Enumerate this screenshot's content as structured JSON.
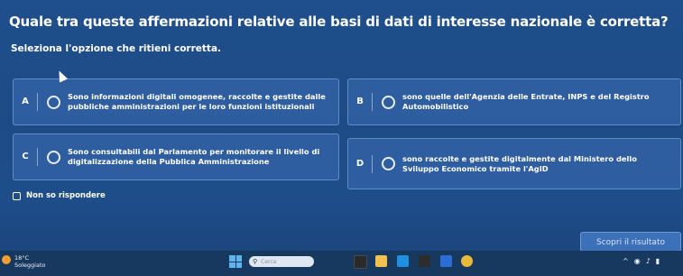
{
  "question": "Quale tra queste affermazioni relative alle basi di dati di interesse nazionale è corretta?",
  "instruction": "Seleziona l'opzione che ritieni corretta.",
  "options": [
    {
      "letter": "A",
      "text": "Sono informazioni digitali omogenee, raccolte e gestite dalle pubbliche amministrazioni per le loro funzioni istituzionali"
    },
    {
      "letter": "B",
      "text": "sono quelle dell'Agenzia delle Entrate, INPS e del Registro Automobilistico"
    },
    {
      "letter": "C",
      "text": "Sono consultabili dal Parlamento per monitorare il livello di digitalizzazione della Pubblica Amministrazione"
    },
    {
      "letter": "D",
      "text": "sono raccolte e gestite digitalmente dal Ministero dello Sviluppo Economico tramite l'AgID"
    }
  ],
  "dont_know": "Non so rispondere",
  "reveal_button": "Scopri il risultato",
  "taskbar": {
    "weather_temp": "18°C",
    "weather_desc": "Soleggiato",
    "search_placeholder": "Cerca"
  },
  "colors": {
    "background": "#1d4b86",
    "option_bg": "#3c6eb4",
    "taskbar": "#17385f"
  }
}
